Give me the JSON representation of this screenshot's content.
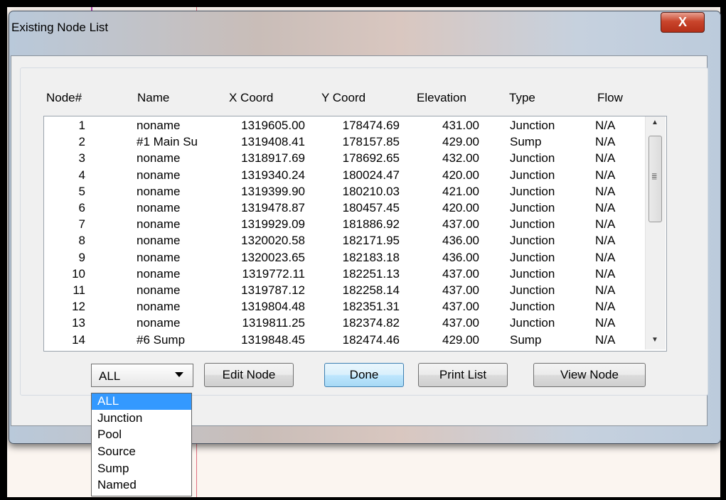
{
  "window": {
    "title": "Existing Node List",
    "close_label": "X"
  },
  "columns": [
    "Node#",
    "Name",
    "X Coord",
    "Y Coord",
    "Elevation",
    "Type",
    "Flow"
  ],
  "rows": [
    {
      "node": "1",
      "name": "noname",
      "x": "1319605.00",
      "y": "178474.69",
      "elev": "431.00",
      "type": "Junction",
      "flow": "N/A"
    },
    {
      "node": "2",
      "name": "#1 Main Su",
      "x": "1319408.41",
      "y": "178157.85",
      "elev": "429.00",
      "type": "Sump",
      "flow": "N/A"
    },
    {
      "node": "3",
      "name": "noname",
      "x": "1318917.69",
      "y": "178692.65",
      "elev": "432.00",
      "type": "Junction",
      "flow": "N/A"
    },
    {
      "node": "4",
      "name": "noname",
      "x": "1319340.24",
      "y": "180024.47",
      "elev": "420.00",
      "type": "Junction",
      "flow": "N/A"
    },
    {
      "node": "5",
      "name": "noname",
      "x": "1319399.90",
      "y": "180210.03",
      "elev": "421.00",
      "type": "Junction",
      "flow": "N/A"
    },
    {
      "node": "6",
      "name": "noname",
      "x": "1319478.87",
      "y": "180457.45",
      "elev": "420.00",
      "type": "Junction",
      "flow": "N/A"
    },
    {
      "node": "7",
      "name": "noname",
      "x": "1319929.09",
      "y": "181886.92",
      "elev": "437.00",
      "type": "Junction",
      "flow": "N/A"
    },
    {
      "node": "8",
      "name": "noname",
      "x": "1320020.58",
      "y": "182171.95",
      "elev": "436.00",
      "type": "Junction",
      "flow": "N/A"
    },
    {
      "node": "9",
      "name": "noname",
      "x": "1320023.65",
      "y": "182183.18",
      "elev": "436.00",
      "type": "Junction",
      "flow": "N/A"
    },
    {
      "node": "10",
      "name": "noname",
      "x": "1319772.11",
      "y": "182251.13",
      "elev": "437.00",
      "type": "Junction",
      "flow": "N/A"
    },
    {
      "node": "11",
      "name": "noname",
      "x": "1319787.12",
      "y": "182258.14",
      "elev": "437.00",
      "type": "Junction",
      "flow": "N/A"
    },
    {
      "node": "12",
      "name": "noname",
      "x": "1319804.48",
      "y": "182351.31",
      "elev": "437.00",
      "type": "Junction",
      "flow": "N/A"
    },
    {
      "node": "13",
      "name": "noname",
      "x": "1319811.25",
      "y": "182374.82",
      "elev": "437.00",
      "type": "Junction",
      "flow": "N/A"
    },
    {
      "node": "14",
      "name": "#6 Sump",
      "x": "1319848.45",
      "y": "182474.46",
      "elev": "429.00",
      "type": "Sump",
      "flow": "N/A"
    }
  ],
  "filter": {
    "selected": "ALL",
    "options": [
      "ALL",
      "Junction",
      "Pool",
      "Source",
      "Sump",
      "Named"
    ]
  },
  "buttons": {
    "edit": "Edit Node",
    "done": "Done",
    "print": "Print List",
    "view": "View Node"
  }
}
